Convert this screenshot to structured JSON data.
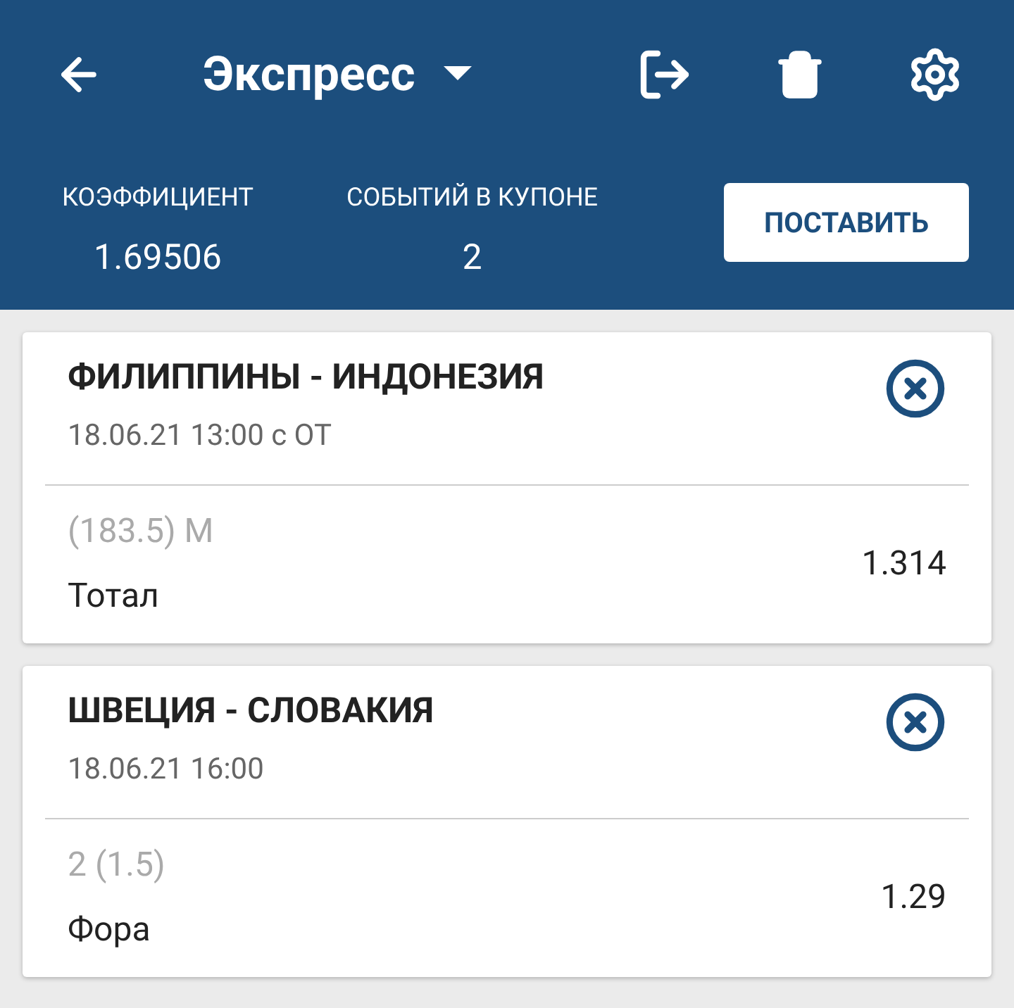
{
  "header": {
    "title": "Экспресс",
    "stats": [
      {
        "label": "КОЭФФИЦИЕНТ",
        "value": "1.69506"
      },
      {
        "label": "СОБЫТИЙ В КУПОНЕ",
        "value": "2"
      }
    ],
    "button": "ПОСТАВИТЬ"
  },
  "bets": [
    {
      "match": "ФИЛИППИНЫ - ИНДОНЕЗИЯ",
      "time": "18.06.21 13:00 с ОТ",
      "outcome": "(183.5) М",
      "market": "Тотал",
      "odd": "1.314"
    },
    {
      "match": "ШВЕЦИЯ - СЛОВАКИЯ",
      "time": "18.06.21 16:00",
      "outcome": "2 (1.5)",
      "market": "Фора",
      "odd": "1.29"
    }
  ]
}
